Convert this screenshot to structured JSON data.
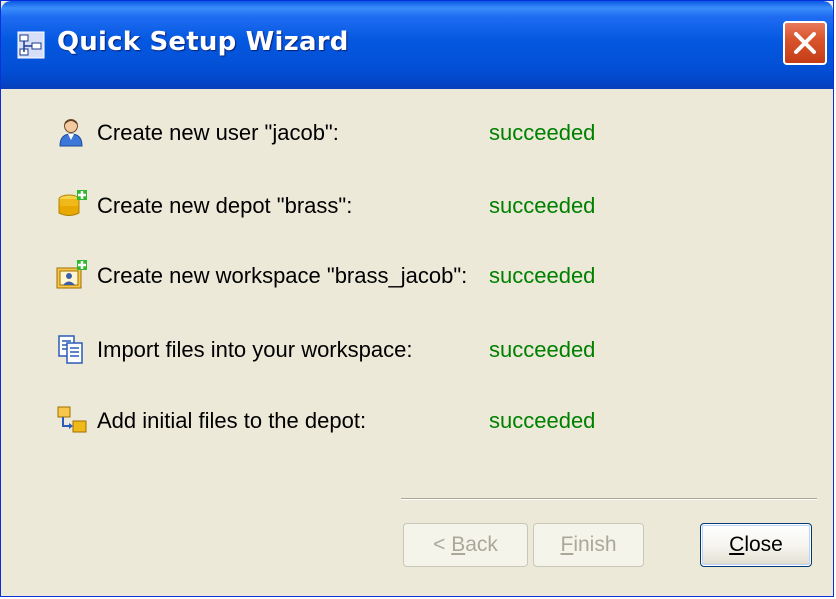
{
  "window": {
    "title": "Quick Setup Wizard"
  },
  "steps": [
    {
      "icon": "user-icon",
      "label": "Create new user \"jacob\":",
      "status": "succeeded"
    },
    {
      "icon": "depot-add-icon",
      "label": "Create new depot \"brass\":",
      "status": "succeeded"
    },
    {
      "icon": "workspace-add-icon",
      "label": "Create new workspace \"brass_jacob\":",
      "status": "succeeded"
    },
    {
      "icon": "import-files-icon",
      "label": "Import files into your workspace:",
      "status": "succeeded"
    },
    {
      "icon": "add-files-depot-icon",
      "label": "Add initial files to the depot:",
      "status": "succeeded"
    }
  ],
  "buttons": {
    "back": {
      "prefix": "< ",
      "mnemonic": "B",
      "rest": "ack",
      "enabled": false
    },
    "finish": {
      "prefix": "",
      "mnemonic": "F",
      "rest": "inish",
      "enabled": false
    },
    "close": {
      "prefix": "",
      "mnemonic": "C",
      "rest": "lose",
      "enabled": true
    }
  },
  "colors": {
    "success": "#008000",
    "titlebar": "#0458e0",
    "close_button": "#d9542c"
  }
}
